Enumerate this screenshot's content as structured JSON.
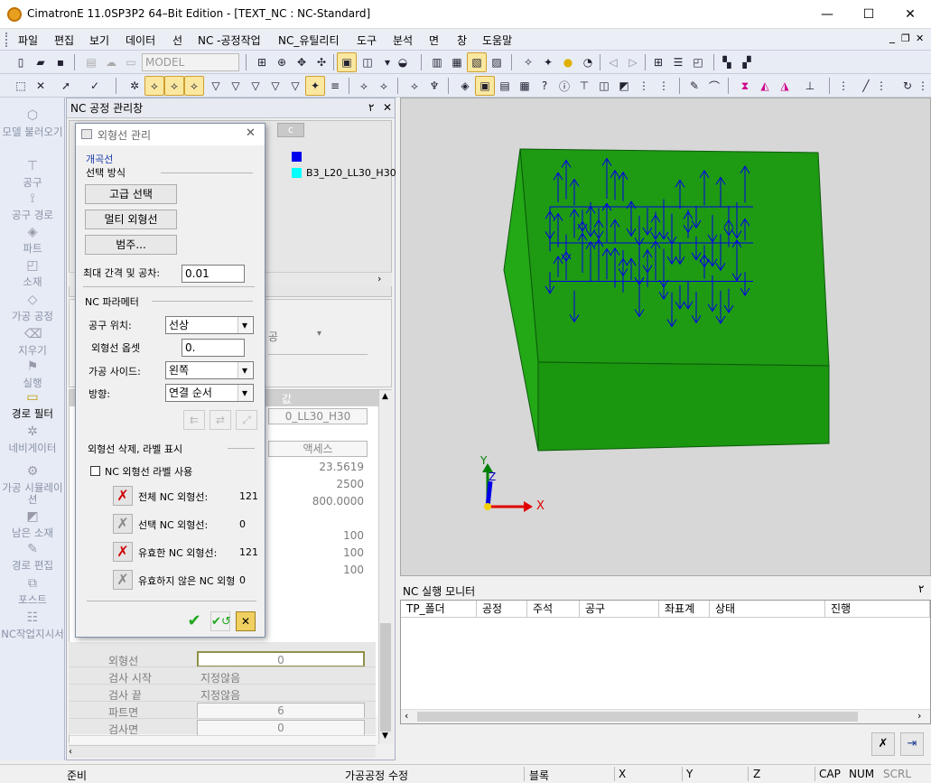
{
  "window": {
    "title": "CimatronE 11.0SP3P2 64–Bit Edition - [TEXT_NC : NC-Standard]",
    "min": "—",
    "max": "☐",
    "close": "✕"
  },
  "menu": [
    "파일",
    "편집",
    "보기",
    "데이터",
    "선",
    "NC -공정작업",
    "NC_유틸리티",
    "도구",
    "분석",
    "면",
    "창",
    "도움말"
  ],
  "menu_right": {
    "min": "_",
    "restore": "❐",
    "close": "✕"
  },
  "toolbar": {
    "model_select": "MODEL"
  },
  "leftbar": [
    {
      "label": "모델 불러오기",
      "icon": "model-load-icon",
      "active": false
    },
    {
      "label": "공구",
      "icon": "tool-icon",
      "active": false
    },
    {
      "label": "공구 경로",
      "icon": "tool-path-icon",
      "active": false
    },
    {
      "label": "파트",
      "icon": "part-icon",
      "active": false
    },
    {
      "label": "소재",
      "icon": "stock-icon",
      "active": false
    },
    {
      "label": "가공 공정",
      "icon": "machining-process-icon",
      "active": false
    },
    {
      "label": "지우기",
      "icon": "erase-icon",
      "active": false
    },
    {
      "label": "실행",
      "icon": "run-icon",
      "active": false
    },
    {
      "label": "경로 필터",
      "icon": "path-filter-icon",
      "active": true
    },
    {
      "label": "네비게이터",
      "icon": "navigator-icon",
      "active": false
    },
    {
      "label": "가공 시뮬레이션",
      "icon": "simulation-icon",
      "active": false
    },
    {
      "label": "남은 소재",
      "icon": "remaining-stock-icon",
      "active": false
    },
    {
      "label": "경로 편집",
      "icon": "path-edit-icon",
      "active": false
    },
    {
      "label": "포스트",
      "icon": "post-icon",
      "active": false
    },
    {
      "label": "NC작업지시서",
      "icon": "nc-worksheet-icon",
      "active": false
    }
  ],
  "nc_panel": {
    "title": "NC 공정 관리창",
    "pin": "٢",
    "close": "✕",
    "col_c": "c",
    "tree_item": "B3_L20_LL30_H30",
    "accent_blue": "#0000ee",
    "accent_cyan": "#00ffff"
  },
  "props": {
    "col_value": "값",
    "rows_partial": [
      "0_LL30_H30",
      "액세스",
      "23.5619",
      "2500",
      "800.0000",
      "100",
      "100",
      "100"
    ],
    "combo_partial": "공",
    "rows": [
      {
        "key": "외형선",
        "val": "0",
        "boxed": true
      },
      {
        "key": "검사 시작",
        "val": "지정않음",
        "boxed": false
      },
      {
        "key": "검사 끝",
        "val": "지정않음",
        "boxed": false
      },
      {
        "key": "파트면",
        "val": "6",
        "boxed": true
      },
      {
        "key": "검사면",
        "val": "0",
        "boxed": true
      }
    ]
  },
  "dialog": {
    "title": "외형선 관리",
    "close": "✕",
    "open_curve": "개곡선",
    "select_method": "선택 방식",
    "btn_advanced": "고급 선택",
    "btn_multi": "멀티 외형선",
    "btn_legend": "범주...",
    "tol_label": "최대 간격 및 공차:",
    "tol_value": "0.01",
    "nc_param": "NC 파라메터",
    "tool_pos_label": "공구 위치:",
    "tool_pos_value": "선상",
    "offset_label": "외형선 옵셋",
    "offset_value": "0.",
    "side_label": "가공 사이드:",
    "side_value": "왼쪽",
    "dir_label": "방향:",
    "dir_value": "연결 순서",
    "delete_group": "외형선 삭제, 라벨 표시",
    "chk_label": "NC 외형선 라벨 사용",
    "counts": [
      {
        "label": "전체 NC 외형선:",
        "value": "121",
        "active": true
      },
      {
        "label": "선택 NC 외형선:",
        "value": "0",
        "active": false
      },
      {
        "label": "유효한 NC 외형선:",
        "value": "121",
        "active": true
      },
      {
        "label": "유효하지 않은 NC 외형",
        "value": "0",
        "active": false
      }
    ]
  },
  "viewport": {
    "axis_x": "X",
    "axis_y": "Y",
    "axis_z": "Z",
    "part_color": "#0a9a0a",
    "path_color": "#0000e6"
  },
  "monitor": {
    "title": "NC 실행 모니터",
    "pin": "٢",
    "cols": [
      "TP_폴더",
      "공정",
      "주석",
      "공구",
      "좌표계",
      "상태",
      "진행"
    ]
  },
  "status": {
    "ready": "준비",
    "mode": "가공공정 수정",
    "block": "블록",
    "x": "X",
    "y": "Y",
    "z": "Z",
    "cap": "CAP",
    "num": "NUM",
    "scrl": "SCRL"
  }
}
